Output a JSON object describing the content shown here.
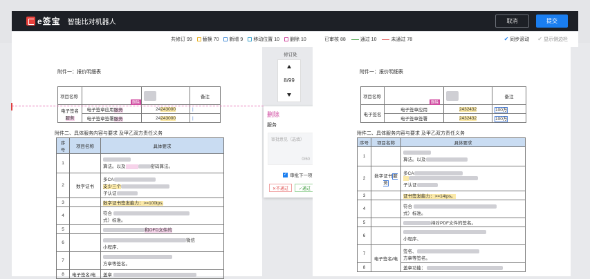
{
  "app": {
    "logo": "e签宝",
    "title": "智能比对机器人",
    "cancel": "取消",
    "submit": "提交"
  },
  "stats": {
    "total": "共修订 99",
    "replace": "替换 70",
    "add": "新增 9",
    "move": "移动位置 10",
    "delete": "删除 10",
    "reviewed": "已审核 88",
    "passed": "通过 10",
    "unpassed": "未通过 78",
    "sync": "同步滚动",
    "sidebar": "显示侧边栏"
  },
  "colors": {
    "replace": "#e8b020",
    "add": "#4a8fd8",
    "move": "#3aa0c8",
    "delete": "#d04aa0",
    "passed": "#3a9a3a",
    "unpassed": "#e05050"
  },
  "nav": {
    "title": "修订处",
    "page": "8/99"
  },
  "review": {
    "type": "删除",
    "content": "服务",
    "placeholder": "审批意见（选填）",
    "count": "0/60",
    "next": "审批下一项",
    "reject": "✕不通过",
    "approve": "✓通过"
  },
  "doc": {
    "att1": "附件一：报价明细表",
    "att2": "附件二、具体服务内容与要求 及甲乙双方责任义务",
    "qhead": [
      "项目名称",
      "备注"
    ],
    "group": "电子签名",
    "svc": "服务",
    "r1": "电子签章应用",
    "r2": "电子签章签署",
    "v1": "243000",
    "v2": "243000",
    "rv1": "2432432",
    "rv2": "2432432",
    "n1": "100万",
    "del_tag": "删除",
    "shead": [
      "序号",
      "项目名称",
      "具体要求"
    ],
    "rows_l": [
      "1",
      "2",
      "3",
      "4",
      "5",
      "6",
      "7",
      "8"
    ],
    "t_algo": "算法。以及",
    "t_pwd": "密码算法。",
    "t_ca": "多CA",
    "t_sup": "支少三个",
    "t_sub": "子认证",
    "t_issue": "数字证书签发能力：>=100tps.",
    "t_issue_r": "证书签发能力：>=14tps。",
    "t_comply": "符合",
    "t_std": "式）标准。",
    "t_digit": "数字证书",
    "t_ofd": "和OFD文件的",
    "t_pdf": "持对PDF文件的签名。",
    "t_mini": "小程序、",
    "t_wechat": "微信",
    "t_sign": "签名、",
    "t_page": "方章等签名。",
    "t_ag": "签名/电",
    "t_cover": "盖章",
    "t_gai": "盖章功能：",
    "t_esig": "电子签名/电"
  }
}
